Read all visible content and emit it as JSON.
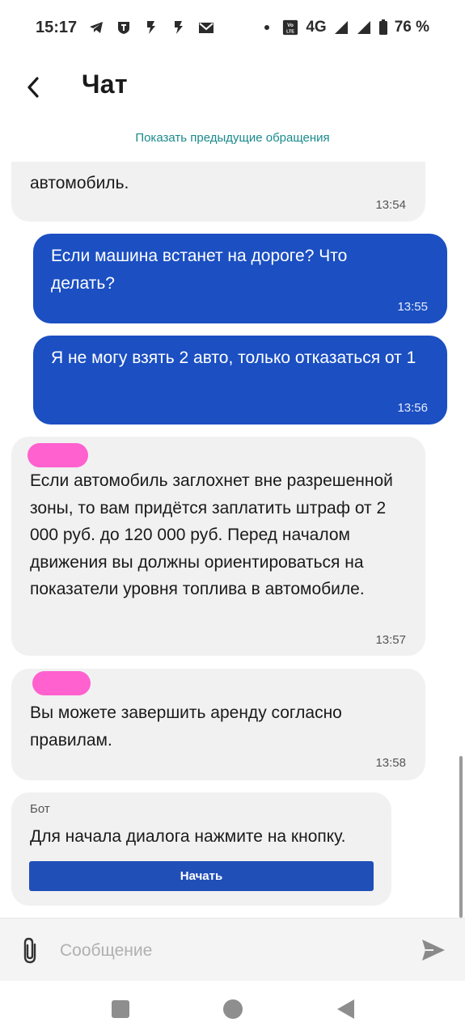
{
  "status_bar": {
    "time": "15:17",
    "network": "4G",
    "volte": "Vo LTE",
    "battery": "76 %",
    "icons": [
      "telegram-icon",
      "shield-t-icon",
      "flash-icon",
      "flash-icon",
      "mail-icon"
    ]
  },
  "header": {
    "title": "Чат"
  },
  "prev_link": "Показать предыдущие обращения",
  "messages": [
    {
      "direction": "incoming",
      "text": "автомобиль.",
      "time": "13:54"
    },
    {
      "direction": "outgoing",
      "text": "Если машина встанет на дороге? Что делать?",
      "time": "13:55"
    },
    {
      "direction": "outgoing",
      "text": "Я не могу взять 2 авто, только отказаться от 1",
      "time": "13:56"
    },
    {
      "direction": "incoming",
      "text": "Если автомобиль заглохнет вне разрешенной зоны, то вам придётся заплатить штраф от 2 000 руб. до 120 000 руб. Перед началом движения вы должны ориентироваться на показатели уровня топлива в автомобиле.",
      "time": "13:57"
    },
    {
      "direction": "incoming",
      "text": "Вы можете завершить аренду согласно правилам.",
      "time": "13:58"
    },
    {
      "direction": "incoming",
      "sender": "Бот",
      "text": "Для начала диалога нажмите на кнопку.",
      "button": "Начать"
    }
  ],
  "input": {
    "placeholder": "Сообщение"
  },
  "colors": {
    "outgoing_bubble": "#1b4fc2",
    "incoming_bubble": "#f1f1f1",
    "link": "#1a8a8c",
    "start_button": "#214fb8"
  }
}
